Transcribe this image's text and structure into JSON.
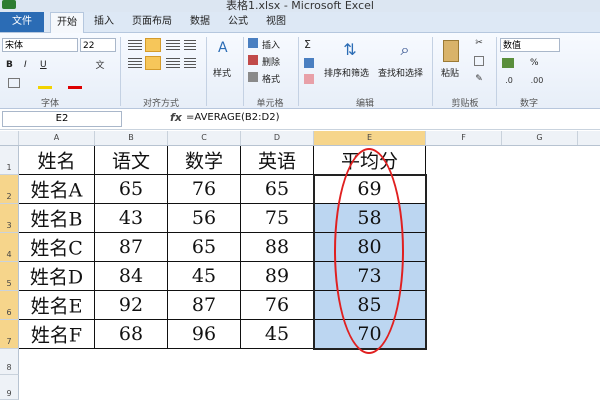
{
  "app": {
    "title": "表格1.xlsx - Microsoft Excel"
  },
  "tabs": [
    "文件",
    "开始",
    "插入",
    "页面布局",
    "数据",
    "公式",
    "视图"
  ],
  "ribbon": {
    "font_name": "宋体",
    "font_size": "22",
    "bold": "B",
    "italic": "I",
    "underline": "U",
    "wrap_text": "A",
    "styles": "样式",
    "insert": "插入",
    "delete": "删除",
    "format": "格式",
    "sum": "Σ",
    "sort_filter": "排序和筛选",
    "find_select": "查找和选择",
    "paste": "粘贴",
    "number_format": "数值",
    "percent": "%",
    "groups": [
      "字体",
      "对齐方式",
      "单元格",
      "编辑",
      "剪贴板",
      "数字"
    ]
  },
  "formula_bar": {
    "cell_ref": "E2",
    "fx": "fx",
    "formula": "=AVERAGE(B2:D2)"
  },
  "grid": {
    "columns": [
      "A",
      "B",
      "C",
      "D",
      "E",
      "F",
      "G"
    ],
    "rows": [
      "1",
      "2",
      "3",
      "4",
      "5",
      "6",
      "7",
      "8",
      "9"
    ],
    "cells": [
      [
        "姓名",
        "语文",
        "数学",
        "英语",
        "平均分"
      ],
      [
        "姓名A",
        "65",
        "76",
        "65",
        "69"
      ],
      [
        "姓名B",
        "43",
        "56",
        "75",
        "58"
      ],
      [
        "姓名C",
        "87",
        "65",
        "88",
        "80"
      ],
      [
        "姓名D",
        "84",
        "45",
        "89",
        "73"
      ],
      [
        "姓名E",
        "92",
        "87",
        "76",
        "85"
      ],
      [
        "姓名F",
        "68",
        "96",
        "45",
        "70"
      ]
    ]
  },
  "colors": {
    "selection": "#bcd6f1",
    "annotation": "#e02020",
    "file_tab": "#2b6cb5"
  }
}
